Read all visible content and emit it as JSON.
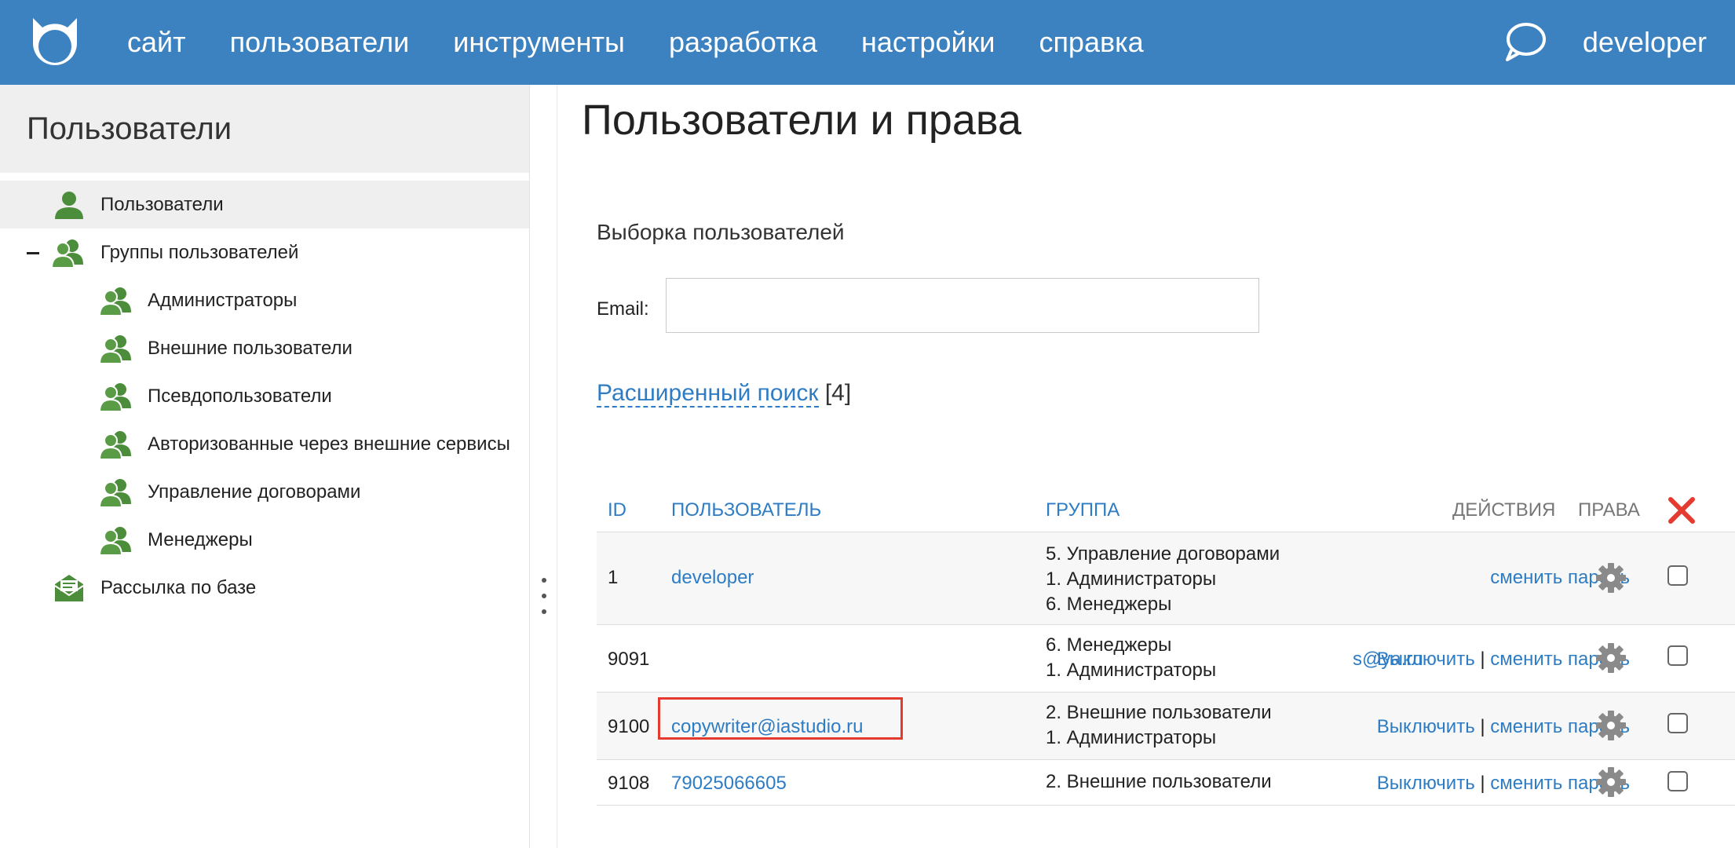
{
  "topbar": {
    "nav": [
      "сайт",
      "пользователи",
      "инструменты",
      "разработка",
      "настройки",
      "справка"
    ],
    "user": "developer",
    "icons": {
      "logo": "cat-logo-icon",
      "chat": "chat-bubble-icon"
    },
    "color": "#3d82c0"
  },
  "sidebar": {
    "title": "Пользователи",
    "items": [
      {
        "label": "Пользователи",
        "icon": "user-icon",
        "active": true
      },
      {
        "label": "Группы пользователей",
        "icon": "users-group-icon"
      },
      {
        "label": "Администраторы",
        "icon": "users-group-icon"
      },
      {
        "label": "Внешние пользователи",
        "icon": "users-group-icon"
      },
      {
        "label": "Псевдопользователи",
        "icon": "users-group-icon"
      },
      {
        "label": "Авторизованные через внешние сервисы",
        "icon": "users-group-icon"
      },
      {
        "label": "Управление договорами",
        "icon": "users-group-icon"
      },
      {
        "label": "Менеджеры",
        "icon": "users-group-icon"
      },
      {
        "label": "Рассылка по базе",
        "icon": "mail-icon"
      }
    ]
  },
  "main": {
    "title": "Пользователи и права",
    "filter_title": "Выборка пользователей",
    "email_label": "Email:",
    "email_value": "",
    "adv_search": "Расширенный поиск",
    "adv_count": "[4]"
  },
  "table": {
    "headers": {
      "id": "ID",
      "user": "ПОЛЬЗОВАТЕЛЬ",
      "group": "ГРУППА",
      "actions": "ДЕЙСТВИЯ",
      "rights": "ПРАВА"
    },
    "rows": [
      {
        "id": "1",
        "user": "developer",
        "groups": [
          "5. Управление договорами",
          "1. Администраторы",
          "6. Менеджеры"
        ],
        "disable": "",
        "change_password": "сменить пароль"
      },
      {
        "id": "9091",
        "user": "s@ya.ru",
        "groups": [
          "6. Менеджеры",
          "1. Администраторы"
        ],
        "disable": "Выключить",
        "change_password": "сменить пароль"
      },
      {
        "id": "9100",
        "user": "copywriter@iastudio.ru",
        "groups": [
          "2. Внешние пользователи",
          "1. Администраторы"
        ],
        "disable": "Выключить",
        "change_password": "сменить пароль"
      },
      {
        "id": "9108",
        "user": "79025066605",
        "groups": [
          "2. Внешние пользователи"
        ],
        "disable": "Выключить",
        "change_password": "сменить пароль"
      }
    ],
    "separator": "|",
    "accent_red": "#e53a2f",
    "link_color": "#2d7cc4"
  }
}
